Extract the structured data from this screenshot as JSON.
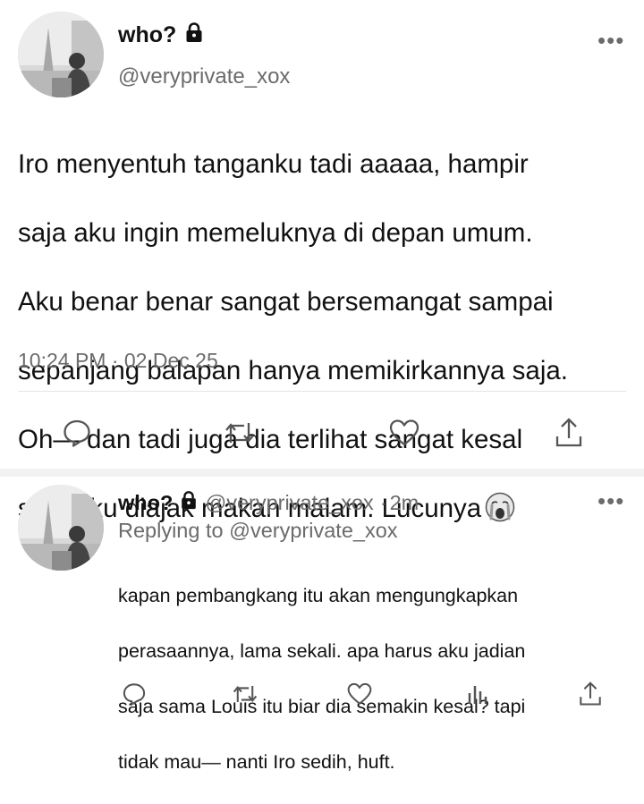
{
  "main_tweet": {
    "display_name": "who?",
    "handle": "@veryprivate_xox",
    "text_lines": [
      "Iro menyentuh tanganku tadi aaaaa, hampir",
      "saja aku ingin memeluknya di depan umum.",
      "Aku benar benar sangat bersemangat sampai",
      "sepanjang balapan hanya memikirkannya saja.",
      "Oh— dan tadi juga dia terlihat sangat kesal",
      "saat aku diajak makan malam. Lucunya"
    ],
    "emoji": "crying-face",
    "timestamp": "10:24 PM · 02 Dec 25",
    "more_label": "•••"
  },
  "reply_tweet": {
    "display_name": "who?",
    "handle": "@veryprivate_xox",
    "separator": "·",
    "age": "2m",
    "replying_to": "Replying to @veryprivate_xox",
    "text_lines": [
      "kapan pembangkang itu akan mengungkapkan",
      "perasaannya, lama sekali. apa harus aku jadian",
      "saja sama Louis itu biar dia semakin kesal? tapi",
      "tidak mau— nanti Iro sedih, huft."
    ],
    "more_label": "•••"
  },
  "icons": {
    "lock": "lock-icon",
    "reply": "reply-icon",
    "retweet": "retweet-icon",
    "like": "heart-icon",
    "share": "share-icon",
    "analytics": "analytics-icon"
  },
  "colors": {
    "text": "#111111",
    "secondary": "#6b6b6b",
    "divider": "#e6e6e6"
  }
}
